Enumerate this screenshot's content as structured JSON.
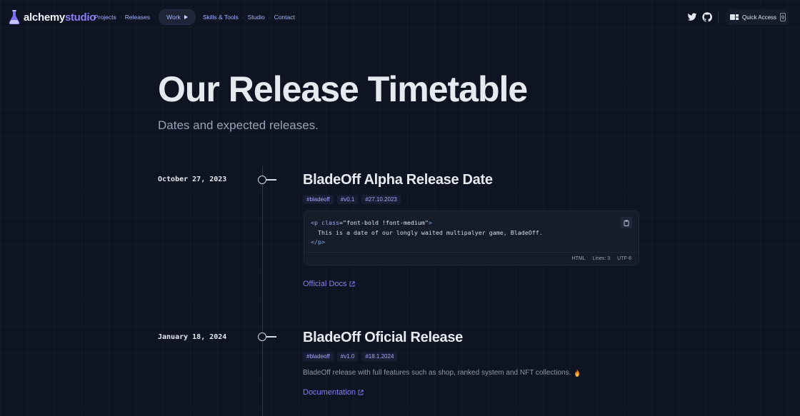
{
  "nav": {
    "logo": {
      "part1": "alchemy",
      "part2": "studio"
    },
    "links": [
      "Projects",
      "Releases"
    ],
    "work_label": "Work",
    "links2": [
      "Skills & Tools",
      "Studio",
      "Contact"
    ],
    "social": [
      "twitter-icon",
      "github-icon"
    ],
    "quick_access": {
      "label": "Quick Access",
      "key": "Q"
    }
  },
  "hero": {
    "title": "Our Release Timetable",
    "subtitle": "Dates and expected releases."
  },
  "entries": [
    {
      "date": "October 27, 2023",
      "title": "BladeOff Alpha Release Date",
      "tags": [
        "#bladeoff",
        "#v0.1",
        "#27.10.2023"
      ],
      "code": {
        "open_lt": "<",
        "open_tag": "p",
        "attr": "class",
        "eq": "=",
        "value": "\"font-bold !font-medium\"",
        "open_gt": ">",
        "text": "This is a date of our longly waited multipalyer game, BladeOff.",
        "close_lt": "</",
        "close_tag": "p",
        "close_gt": ">",
        "language": "HTML",
        "lines": "Lines: 3",
        "encoding": "UTF-8"
      },
      "link": "Official Docs"
    },
    {
      "date": "January 18, 2024",
      "title": "BladeOff Oficial Release",
      "tags": [
        "#bladeoff",
        "#v1.0",
        "#18.1.2024"
      ],
      "description": "BladeOff release with full features such as shop, ranked system and NFT collections.",
      "link": "Documentation"
    }
  ],
  "colors": {
    "accent": "#8b7cf6",
    "background": "#0f1422",
    "tag_text": "#a8a8f8"
  }
}
